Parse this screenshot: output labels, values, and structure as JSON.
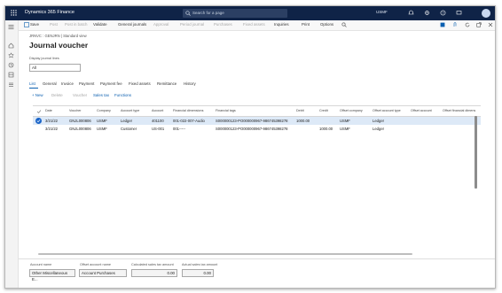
{
  "app": {
    "title": "Dynamics 365 Finance"
  },
  "search": {
    "placeholder": "Search for a page"
  },
  "header": {
    "company": "USMF"
  },
  "actions": {
    "save": "Save",
    "post": "Post",
    "post_and_transfer": "Post in batch",
    "validate": "Validate",
    "general_journals": "General journals",
    "approval": "Approval",
    "period_journal": "Period journal",
    "purchases": "Purchases",
    "fixed_assets": "Fixed assets",
    "inquiries": "Inquiries",
    "print": "Print",
    "options": "Options"
  },
  "breadcrumb": "JRNVC : GENJRN  |  Standard view",
  "page_title": "Journal voucher",
  "display_journal_lines": {
    "label": "Display journal lines",
    "value": "All"
  },
  "tabs": [
    "List",
    "General",
    "Invoice",
    "Payment",
    "Payment fee",
    "Fixed assets",
    "Remittance",
    "History"
  ],
  "grid_toolbar": {
    "new": "+ New",
    "delete": "Delete",
    "voucher": "Voucher",
    "sales_tax": "Sales tax",
    "functions": "Functions"
  },
  "grid": {
    "columns": [
      "Date",
      "Voucher",
      "Company",
      "Account type",
      "Account",
      "Financial dimensions",
      "Financial tags",
      "Debit",
      "Credit",
      "Offset company",
      "Offset account type",
      "Offset account",
      "Offset financial dimens"
    ],
    "rows": [
      [
        "3/21/22",
        "GNJL000806",
        "USMF",
        "Ledger",
        "401100",
        "001-022-007-Audio",
        "S000000123-PO000000967-986745398278",
        "1000.00",
        "",
        "USMF",
        "Ledger",
        "",
        ""
      ],
      [
        "3/21/22",
        "GNJL000806",
        "USMF",
        "Customer",
        "US-001",
        "001-----",
        "S000000123-PO000000967-986745398278",
        "",
        "1000.00",
        "USMF",
        "Ledger",
        "",
        ""
      ]
    ]
  },
  "footer": {
    "account_name": {
      "label": "Account name",
      "value": "Other Miscellaneous E..."
    },
    "offset_account_name": {
      "label": "Offset account name",
      "value": "Account Purchases"
    },
    "calculated_sales_tax": {
      "label": "Calculated sales tax amount",
      "value": "0.00"
    },
    "actual_sales_tax": {
      "label": "Actual sales tax amount",
      "value": "0.00"
    }
  },
  "colors": {
    "topbar": "#0f2347",
    "accent": "#0b5fb0",
    "selected_row": "#dde9f7"
  }
}
